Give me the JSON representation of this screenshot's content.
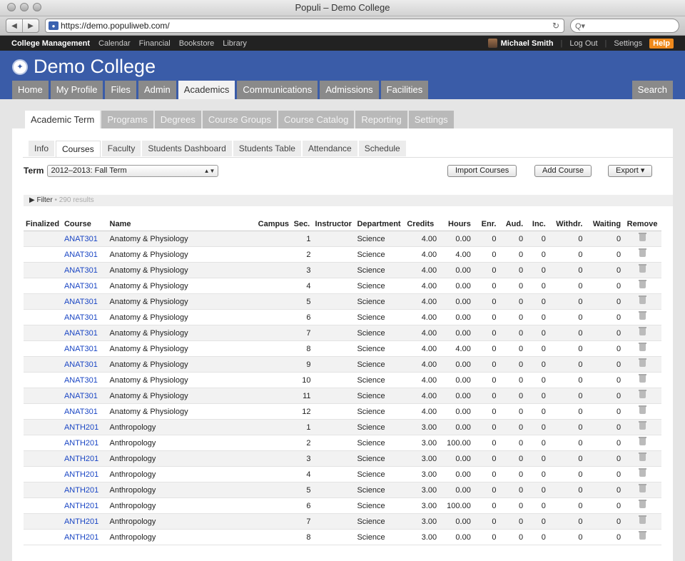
{
  "browser": {
    "title": "Populi – Demo College",
    "url": "https://demo.populiweb.com/",
    "search_placeholder": "Q▾"
  },
  "topbar": {
    "links": [
      "College Management",
      "Calendar",
      "Financial",
      "Bookstore",
      "Library"
    ],
    "user": "Michael Smith",
    "logout": "Log Out",
    "settings": "Settings",
    "help": "Help"
  },
  "header": {
    "college": "Demo College",
    "tabs": [
      "Home",
      "My Profile",
      "Files",
      "Admin",
      "Academics",
      "Communications",
      "Admissions",
      "Facilities"
    ],
    "search": "Search"
  },
  "subtabs": [
    "Academic Term",
    "Programs",
    "Degrees",
    "Course Groups",
    "Course Catalog",
    "Reporting",
    "Settings"
  ],
  "innertabs": [
    "Info",
    "Courses",
    "Faculty",
    "Students Dashboard",
    "Students Table",
    "Attendance",
    "Schedule"
  ],
  "term": {
    "label": "Term",
    "value": "2012–2013: Fall Term"
  },
  "buttons": {
    "import": "Import Courses",
    "add": "Add Course",
    "export": "Export ▾"
  },
  "filter": {
    "label": "▶ Filter",
    "results": "290 results"
  },
  "table": {
    "headers": [
      "Finalized",
      "Course",
      "Name",
      "Campus",
      "Sec.",
      "Instructor",
      "Department",
      "Credits",
      "Hours",
      "Enr.",
      "Aud.",
      "Inc.",
      "Withdr.",
      "Waiting",
      "Remove"
    ],
    "rows": [
      [
        "ANAT301",
        "Anatomy & Physiology",
        "1",
        "Science",
        "4.00",
        "0.00",
        "0",
        "0",
        "0",
        "0",
        "0"
      ],
      [
        "ANAT301",
        "Anatomy & Physiology",
        "2",
        "Science",
        "4.00",
        "4.00",
        "0",
        "0",
        "0",
        "0",
        "0"
      ],
      [
        "ANAT301",
        "Anatomy & Physiology",
        "3",
        "Science",
        "4.00",
        "0.00",
        "0",
        "0",
        "0",
        "0",
        "0"
      ],
      [
        "ANAT301",
        "Anatomy & Physiology",
        "4",
        "Science",
        "4.00",
        "0.00",
        "0",
        "0",
        "0",
        "0",
        "0"
      ],
      [
        "ANAT301",
        "Anatomy & Physiology",
        "5",
        "Science",
        "4.00",
        "0.00",
        "0",
        "0",
        "0",
        "0",
        "0"
      ],
      [
        "ANAT301",
        "Anatomy & Physiology",
        "6",
        "Science",
        "4.00",
        "0.00",
        "0",
        "0",
        "0",
        "0",
        "0"
      ],
      [
        "ANAT301",
        "Anatomy & Physiology",
        "7",
        "Science",
        "4.00",
        "0.00",
        "0",
        "0",
        "0",
        "0",
        "0"
      ],
      [
        "ANAT301",
        "Anatomy & Physiology",
        "8",
        "Science",
        "4.00",
        "4.00",
        "0",
        "0",
        "0",
        "0",
        "0"
      ],
      [
        "ANAT301",
        "Anatomy & Physiology",
        "9",
        "Science",
        "4.00",
        "0.00",
        "0",
        "0",
        "0",
        "0",
        "0"
      ],
      [
        "ANAT301",
        "Anatomy & Physiology",
        "10",
        "Science",
        "4.00",
        "0.00",
        "0",
        "0",
        "0",
        "0",
        "0"
      ],
      [
        "ANAT301",
        "Anatomy & Physiology",
        "11",
        "Science",
        "4.00",
        "0.00",
        "0",
        "0",
        "0",
        "0",
        "0"
      ],
      [
        "ANAT301",
        "Anatomy & Physiology",
        "12",
        "Science",
        "4.00",
        "0.00",
        "0",
        "0",
        "0",
        "0",
        "0"
      ],
      [
        "ANTH201",
        "Anthropology",
        "1",
        "Science",
        "3.00",
        "0.00",
        "0",
        "0",
        "0",
        "0",
        "0"
      ],
      [
        "ANTH201",
        "Anthropology",
        "2",
        "Science",
        "3.00",
        "100.00",
        "0",
        "0",
        "0",
        "0",
        "0"
      ],
      [
        "ANTH201",
        "Anthropology",
        "3",
        "Science",
        "3.00",
        "0.00",
        "0",
        "0",
        "0",
        "0",
        "0"
      ],
      [
        "ANTH201",
        "Anthropology",
        "4",
        "Science",
        "3.00",
        "0.00",
        "0",
        "0",
        "0",
        "0",
        "0"
      ],
      [
        "ANTH201",
        "Anthropology",
        "5",
        "Science",
        "3.00",
        "0.00",
        "0",
        "0",
        "0",
        "0",
        "0"
      ],
      [
        "ANTH201",
        "Anthropology",
        "6",
        "Science",
        "3.00",
        "100.00",
        "0",
        "0",
        "0",
        "0",
        "0"
      ],
      [
        "ANTH201",
        "Anthropology",
        "7",
        "Science",
        "3.00",
        "0.00",
        "0",
        "0",
        "0",
        "0",
        "0"
      ],
      [
        "ANTH201",
        "Anthropology",
        "8",
        "Science",
        "3.00",
        "0.00",
        "0",
        "0",
        "0",
        "0",
        "0"
      ]
    ]
  }
}
